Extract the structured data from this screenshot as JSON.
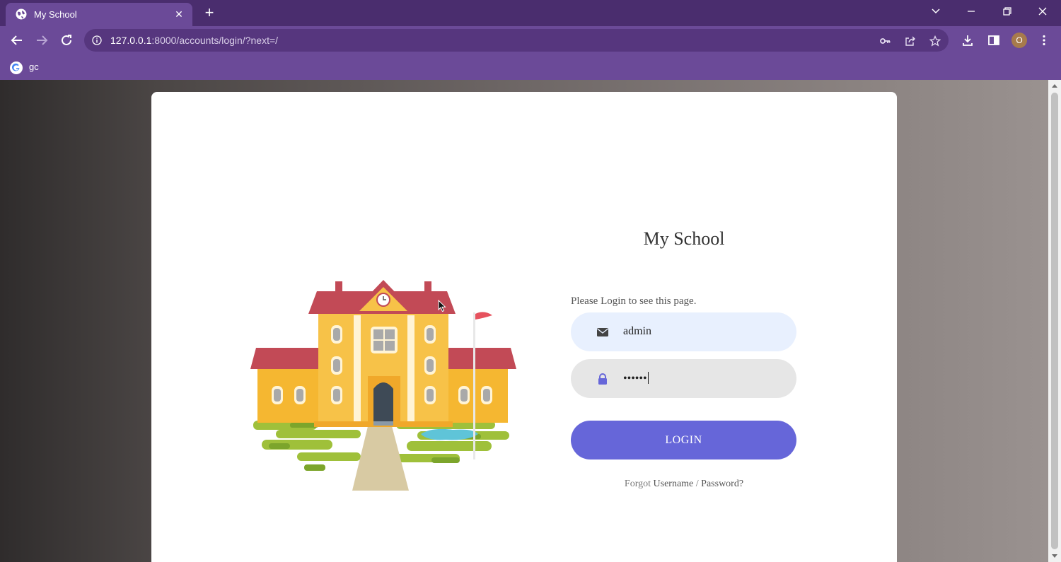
{
  "browser": {
    "tab": {
      "title": "My School",
      "favicon": "globe-icon",
      "close_icon": "close-icon"
    },
    "new_tab_icon": "plus-icon",
    "window_controls": [
      "chevron-down-icon",
      "minimize-icon",
      "restore-icon",
      "close-icon"
    ],
    "address_bar": {
      "url_host": "127.0.0.1",
      "url_rest": ":8000/accounts/login/?next=/",
      "icon": "info-icon"
    },
    "omnibox_icons": [
      "key-icon",
      "share-icon",
      "star-icon"
    ],
    "toolbar_icons": [
      "download-icon",
      "sidepanel-icon",
      "kebab-menu-icon"
    ],
    "profile_initial": "O",
    "bookmarks": [
      {
        "label": "gc",
        "icon": "google-icon"
      }
    ]
  },
  "page": {
    "site_title": "My School",
    "prompt": "Please Login to see this page.",
    "username": {
      "value": "admin",
      "icon": "envelope-icon"
    },
    "password": {
      "masked_value": "••••••",
      "icon": "lock-icon"
    },
    "login_button": "LOGIN",
    "forgot": {
      "prefix": "Forgot",
      "username": "Username",
      "separator": "/",
      "password": "Password?"
    },
    "illustration": "school-building-illustration"
  },
  "colors": {
    "tabstrip": "#4a2d6e",
    "toolbar": "#6b4a98",
    "login_button": "#6666d9",
    "username_field": "#e8f0fe",
    "password_field": "#e6e6e6"
  }
}
